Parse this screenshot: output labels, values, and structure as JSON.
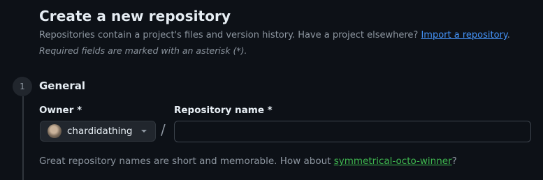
{
  "header": {
    "title": "Create a new repository",
    "subtitle_text": "Repositories contain a project's files and version history. Have a project elsewhere? ",
    "import_link": "Import a repository",
    "subtitle_end": ".",
    "required_note": "Required fields are marked with an asterisk (*)."
  },
  "general": {
    "step_number": "1",
    "title": "General",
    "owner_label": "Owner *",
    "owner_value": "chardidathing",
    "separator": "/",
    "repo_label": "Repository name *",
    "repo_value": "",
    "hint_text": "Great repository names are short and memorable. How about ",
    "suggestion": "symmetrical-octo-winner",
    "hint_end": "?"
  },
  "icons": {
    "owner_caret": "triangle-down-icon",
    "owner_avatar": "avatar-icon"
  }
}
